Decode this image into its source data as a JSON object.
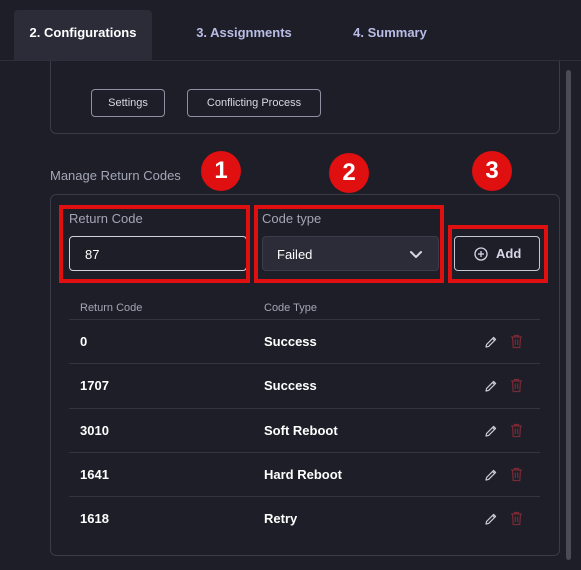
{
  "tabs": [
    {
      "label": "2. Configurations",
      "active": true
    },
    {
      "label": "3. Assignments",
      "active": false
    },
    {
      "label": "4. Summary",
      "active": false
    }
  ],
  "top_panel": {
    "buttons": [
      "Settings",
      "Conflicting Process"
    ]
  },
  "section": {
    "title": "Manage Return Codes"
  },
  "form": {
    "return_code_label": "Return Code",
    "return_code_value": "87",
    "code_type_label": "Code type",
    "code_type_value": "Failed",
    "add_label": "Add"
  },
  "table": {
    "headers": [
      "Return Code",
      "Code Type"
    ],
    "rows": [
      {
        "code": "0",
        "type": "Success"
      },
      {
        "code": "1707",
        "type": "Success"
      },
      {
        "code": "3010",
        "type": "Soft Reboot"
      },
      {
        "code": "1641",
        "type": "Hard Reboot"
      },
      {
        "code": "1618",
        "type": "Retry"
      }
    ]
  },
  "callouts": [
    "1",
    "2",
    "3"
  ],
  "colors": {
    "background": "#1d1e27",
    "active_tab": "#2b2c38",
    "tab_text": "#b9bde6",
    "callout_red": "#e00f10",
    "delete_icon": "#7a2a36"
  },
  "icons": [
    "chevron-down-icon",
    "plus-circle-icon",
    "pencil-icon",
    "trash-icon"
  ]
}
